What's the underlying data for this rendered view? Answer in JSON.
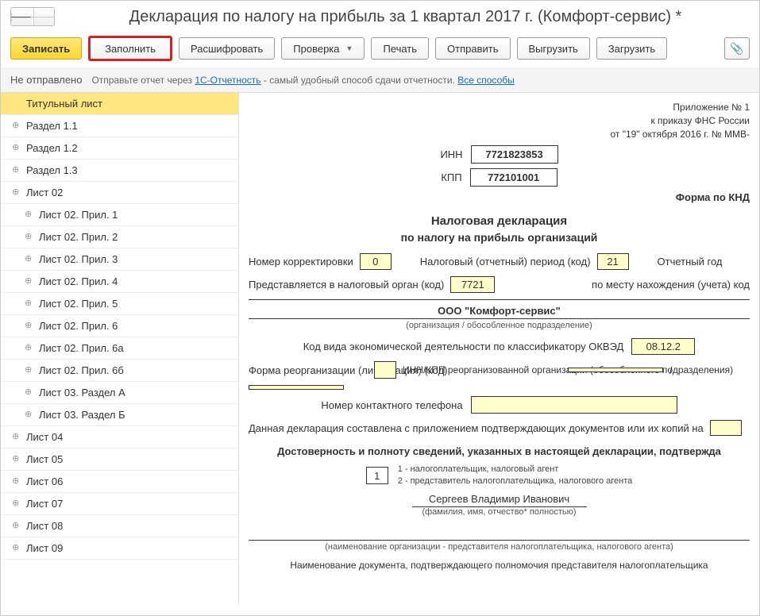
{
  "title": "Декларация по налогу на прибыль за 1 квартал 2017 г. (Комфорт-сервис) *",
  "toolbar": {
    "save": "Записать",
    "fill": "Заполнить",
    "decode": "Расшифровать",
    "check": "Проверка",
    "print": "Печать",
    "send": "Отправить",
    "export": "Выгрузить",
    "import": "Загрузить"
  },
  "status": {
    "text": "Не отправлено",
    "hint_prefix": "Отправьте отчет через ",
    "hint_link": "1С-Отчетность",
    "hint_suffix": " - самый удобный способ сдачи отчетности. ",
    "all_methods": "Все способы"
  },
  "sidebar": [
    {
      "label": "Титульный лист",
      "selected": true,
      "indent": false
    },
    {
      "label": "Раздел 1.1",
      "indent": false
    },
    {
      "label": "Раздел 1.2",
      "indent": false
    },
    {
      "label": "Раздел 1.3",
      "indent": false
    },
    {
      "label": "Лист 02",
      "indent": false
    },
    {
      "label": "Лист 02. Прил. 1",
      "indent": true
    },
    {
      "label": "Лист 02. Прил. 2",
      "indent": true
    },
    {
      "label": "Лист 02. Прил. 3",
      "indent": true
    },
    {
      "label": "Лист 02. Прил. 4",
      "indent": true
    },
    {
      "label": "Лист 02. Прил. 5",
      "indent": true
    },
    {
      "label": "Лист 02. Прил. 6",
      "indent": true
    },
    {
      "label": "Лист 02. Прил. 6а",
      "indent": true
    },
    {
      "label": "Лист 02. Прил. 6б",
      "indent": true
    },
    {
      "label": "Лист 03. Раздел А",
      "indent": true
    },
    {
      "label": "Лист 03. Раздел Б",
      "indent": true
    },
    {
      "label": "Лист 04",
      "indent": false
    },
    {
      "label": "Лист 05",
      "indent": false
    },
    {
      "label": "Лист 06",
      "indent": false
    },
    {
      "label": "Лист 07",
      "indent": false
    },
    {
      "label": "Лист 08",
      "indent": false
    },
    {
      "label": "Лист 09",
      "indent": false
    }
  ],
  "doc": {
    "appendix": "Приложение № 1",
    "order": "к приказу ФНС России",
    "date": "от \"19\" октября 2016 г. № ММВ-",
    "inn_label": "ИНН",
    "inn": "7721823853",
    "kpp_label": "КПП",
    "kpp": "772101001",
    "form_knd_label": "Форма по КНД",
    "title1": "Налоговая декларация",
    "title2": "по налогу на прибыль организаций",
    "corr_label": "Номер корректировки",
    "corr": "0",
    "period_label": "Налоговый (отчетный) период (код)",
    "period": "21",
    "year_label": "Отчетный год",
    "submit_label": "Представляется в налоговый орган (код)",
    "submit_code": "7721",
    "location_label": "по месту нахождения (учета) код",
    "org_name": "ООО \"Комфорт-сервис\"",
    "org_caption": "(организация / обособленное подразделение)",
    "okved_label": "Код вида экономической деятельности по классификатору ОКВЭД",
    "okved": "08.12.2",
    "reorg_label": "Форма реорганизации (ликвидация) (код)",
    "reorg_inn_label": "ИНН/КПП реорганизованной организации (обособленного подразделения)",
    "phone_label": "Номер контактного телефона",
    "attach_label": "Данная декларация составлена с приложением подтверждающих документов или их копий на",
    "confirm_title": "Достоверность и полноту сведений, указанных в настоящей декларации, подтвержда",
    "signer_code": "1",
    "signer_legend1": "1 - налогоплательщик, налоговый агент",
    "signer_legend2": "2 - представитель налогоплательщика, налогового агента",
    "signer_name": "Сергеев Владимир Иванович",
    "signer_caption": "(фамилия, имя, отчество* полностью)",
    "rep_org_caption": "(наименование организации - представителя налогоплательщика, налогового агента)",
    "doc_confirm": "Наименование документа, подтверждающего полномочия представителя налогоплательщика"
  }
}
